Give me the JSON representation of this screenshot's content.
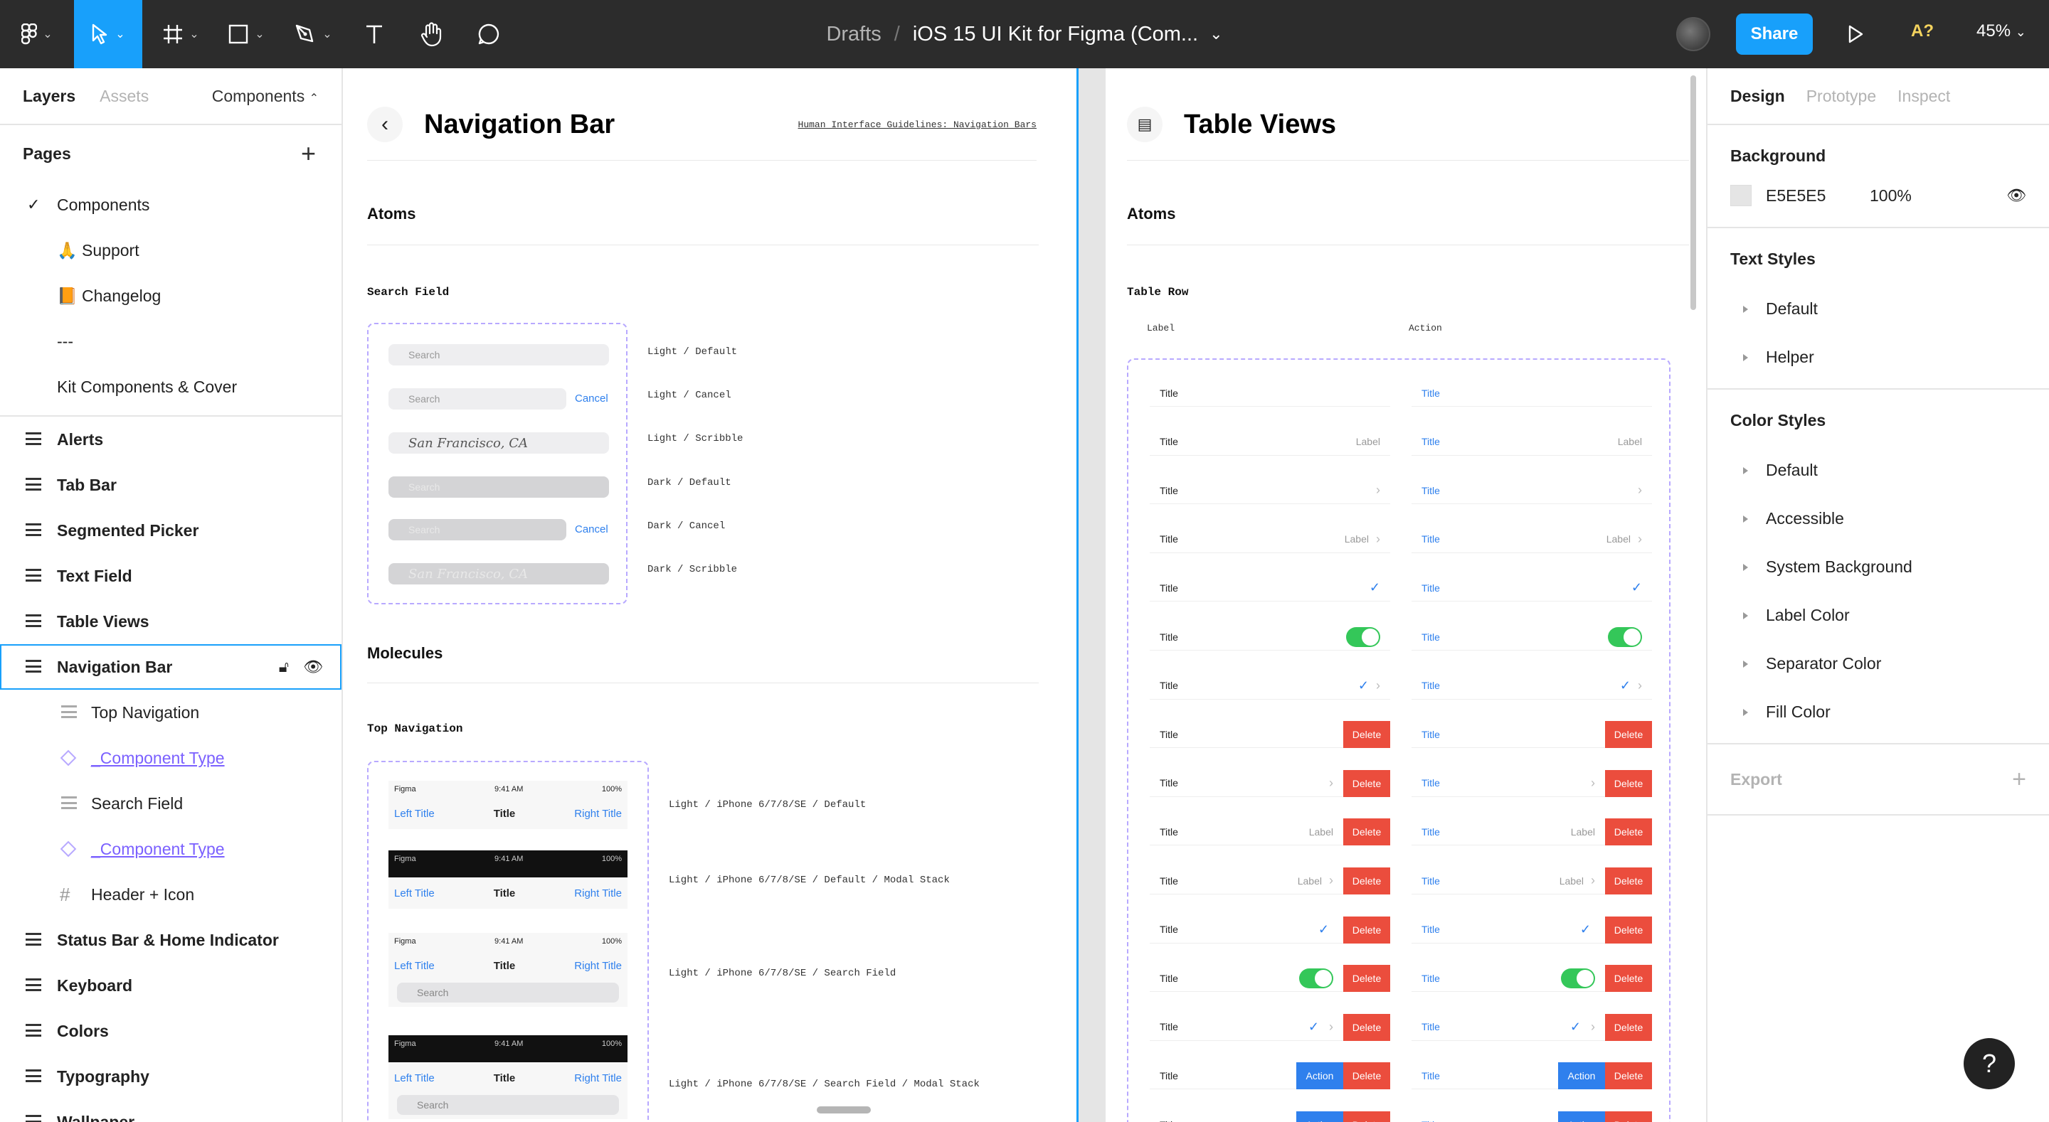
{
  "topbar": {
    "drafts": "Drafts",
    "separator": "/",
    "file_title": "iOS 15 UI Kit for Figma (Com...",
    "share_label": "Share",
    "a11y_label": "A?",
    "zoom": "45%"
  },
  "left_panel": {
    "tabs": [
      "Layers",
      "Assets"
    ],
    "components_label": "Components",
    "pages_title": "Pages",
    "pages": [
      "Components",
      "🙏 Support",
      "📙 Changelog",
      "---",
      "Kit Components & Cover"
    ],
    "layers": [
      {
        "label": "Alerts"
      },
      {
        "label": "Tab Bar"
      },
      {
        "label": "Segmented Picker"
      },
      {
        "label": "Text Field"
      },
      {
        "label": "Table Views"
      },
      {
        "label": "Navigation Bar"
      },
      {
        "label": "Top Navigation"
      },
      {
        "label": "_Component Type"
      },
      {
        "label": "Search Field"
      },
      {
        "label": "_Component Type"
      },
      {
        "label": "Header + Icon"
      },
      {
        "label": "Status Bar & Home Indicator"
      },
      {
        "label": "Keyboard"
      },
      {
        "label": "Colors"
      },
      {
        "label": "Typography"
      },
      {
        "label": "Wallpaper"
      }
    ]
  },
  "frame1": {
    "title": "Navigation Bar",
    "link": "Human Interface Guidelines: Navigation Bars",
    "atoms": "Atoms",
    "search_field_title": "Search Field",
    "search_placeholder": "Search",
    "cancel": "Cancel",
    "scribble": "San Francisco, CA",
    "search_variants": [
      "Light / Default",
      "Light / Cancel",
      "Light / Scribble",
      "Dark / Default",
      "Dark / Cancel",
      "Dark / Scribble"
    ],
    "molecules": "Molecules",
    "top_nav_title": "Top Navigation",
    "status_left": "Figma",
    "status_time": "9:41 AM",
    "status_right": "100%",
    "nav_left": "Left Title",
    "nav_center": "Title",
    "nav_right": "Right Title",
    "top_nav_variants": [
      "Light / iPhone 6/7/8/SE / Default",
      "Light / iPhone 6/7/8/SE / Default / Modal Stack",
      "Light / iPhone 6/7/8/SE / Search Field",
      "Light / iPhone 6/7/8/SE / Search Field / Modal Stack"
    ]
  },
  "frame2": {
    "title": "Table Views",
    "atoms": "Atoms",
    "table_row_title": "Table Row",
    "col_label": "Label",
    "col_action": "Action",
    "row_title": "Title",
    "row_label": "Label",
    "delete": "Delete",
    "action": "Action"
  },
  "right_panel": {
    "tabs": [
      "Design",
      "Prototype",
      "Inspect"
    ],
    "background_title": "Background",
    "bg_hex": "E5E5E5",
    "bg_opacity": "100%",
    "text_styles_title": "Text Styles",
    "text_styles": [
      "Default",
      "Helper"
    ],
    "color_styles_title": "Color Styles",
    "color_styles": [
      "Default",
      "Accessible",
      "System Background",
      "Label Color",
      "Separator Color",
      "Fill Color"
    ],
    "export_title": "Export"
  },
  "help_label": "?"
}
